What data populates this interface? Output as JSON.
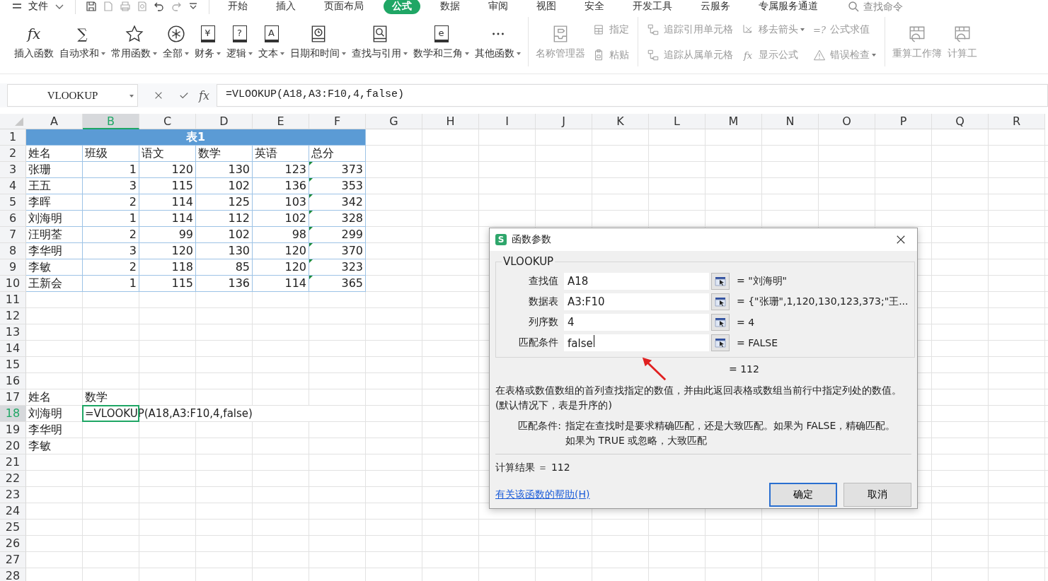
{
  "menu": {
    "file_label": "文件",
    "search_placeholder": "查找命令",
    "tabs": [
      {
        "label": "开始",
        "selected": false
      },
      {
        "label": "插入",
        "selected": false
      },
      {
        "label": "页面布局",
        "selected": false
      },
      {
        "label": "公式",
        "selected": true
      },
      {
        "label": "数据",
        "selected": false
      },
      {
        "label": "审阅",
        "selected": false
      },
      {
        "label": "视图",
        "selected": false
      },
      {
        "label": "安全",
        "selected": false
      },
      {
        "label": "开发工具",
        "selected": false
      },
      {
        "label": "云服务",
        "selected": false
      },
      {
        "label": "专属服务通道",
        "selected": false
      }
    ]
  },
  "ribbon": {
    "groups": [
      {
        "items": [
          {
            "kind": "large",
            "glyph": "fx",
            "label": "插入函数",
            "dropdown": false,
            "disabled": false
          },
          {
            "kind": "large",
            "glyph": "∑",
            "label": "自动求和",
            "dropdown": true,
            "disabled": false
          },
          {
            "kind": "large",
            "label": "常用函数",
            "dropdown": true,
            "disabled": false
          },
          {
            "kind": "large",
            "label": "全部",
            "dropdown": true,
            "disabled": false
          },
          {
            "kind": "large",
            "glyph": "¥",
            "label": "财务",
            "dropdown": true,
            "disabled": false
          },
          {
            "kind": "large",
            "glyph": "?",
            "label": "逻辑",
            "dropdown": true,
            "disabled": false
          },
          {
            "kind": "large",
            "glyph": "A",
            "label": "文本",
            "dropdown": true,
            "disabled": false
          },
          {
            "kind": "large",
            "label": "日期和时间",
            "dropdown": true,
            "disabled": false
          },
          {
            "kind": "large",
            "label": "查找与引用",
            "dropdown": true,
            "disabled": false
          },
          {
            "kind": "large",
            "glyph": "e",
            "label": "数学和三角",
            "dropdown": true,
            "disabled": false
          },
          {
            "kind": "large",
            "label": "其他函数",
            "dropdown": true,
            "disabled": false
          }
        ]
      },
      {
        "items": [
          {
            "kind": "large",
            "label": "名称管理器",
            "dropdown": false,
            "disabled": true
          },
          {
            "kind": "small",
            "label": "指定",
            "dropdown": false,
            "disabled": true
          },
          {
            "kind": "small",
            "label": "粘贴",
            "dropdown": false,
            "disabled": true
          }
        ]
      },
      {
        "items": [
          {
            "kind": "small",
            "label": "追踪引用单元格",
            "dropdown": false,
            "disabled": true
          },
          {
            "kind": "small",
            "label": "移去箭头",
            "dropdown": true,
            "disabled": true
          },
          {
            "kind": "small",
            "glyph": "=?",
            "label": "公式求值",
            "dropdown": false,
            "disabled": true
          },
          {
            "kind": "small",
            "label": "追踪从属单元格",
            "dropdown": false,
            "disabled": true
          },
          {
            "kind": "small",
            "glyph": "fx",
            "label": "显示公式",
            "dropdown": false,
            "disabled": true
          },
          {
            "kind": "small",
            "label": "错误检查",
            "dropdown": true,
            "disabled": true
          }
        ]
      },
      {
        "items": [
          {
            "kind": "large",
            "label": "重算工作簿",
            "dropdown": false,
            "disabled": true
          },
          {
            "kind": "large",
            "label": "计算工",
            "dropdown": false,
            "disabled": true
          }
        ]
      }
    ]
  },
  "formula_bar": {
    "name_box": "VLOOKUP",
    "fx": "fx",
    "formula": "=VLOOKUP(A18,A3:F10,4,false)"
  },
  "sheet": {
    "columns": [
      {
        "label": "A",
        "selected": false
      },
      {
        "label": "B",
        "selected": true
      },
      {
        "label": "C",
        "selected": false
      },
      {
        "label": "D",
        "selected": false
      },
      {
        "label": "E",
        "selected": false
      },
      {
        "label": "F",
        "selected": false
      },
      {
        "label": "G",
        "selected": false
      },
      {
        "label": "H",
        "selected": false
      },
      {
        "label": "I",
        "selected": false
      },
      {
        "label": "J",
        "selected": false
      },
      {
        "label": "K",
        "selected": false
      },
      {
        "label": "L",
        "selected": false
      },
      {
        "label": "M",
        "selected": false
      },
      {
        "label": "N",
        "selected": false
      },
      {
        "label": "O",
        "selected": false
      },
      {
        "label": "P",
        "selected": false
      },
      {
        "label": "Q",
        "selected": false
      },
      {
        "label": "R",
        "selected": false
      }
    ],
    "rows": [
      {
        "label": "1",
        "selected": false
      },
      {
        "label": "2",
        "selected": false
      },
      {
        "label": "3",
        "selected": false
      },
      {
        "label": "4",
        "selected": false
      },
      {
        "label": "5",
        "selected": false
      },
      {
        "label": "6",
        "selected": false
      },
      {
        "label": "7",
        "selected": false
      },
      {
        "label": "8",
        "selected": false
      },
      {
        "label": "9",
        "selected": false
      },
      {
        "label": "10",
        "selected": false
      },
      {
        "label": "11",
        "selected": false
      },
      {
        "label": "12",
        "selected": false
      },
      {
        "label": "13",
        "selected": false
      },
      {
        "label": "14",
        "selected": false
      },
      {
        "label": "15",
        "selected": false
      },
      {
        "label": "16",
        "selected": false
      },
      {
        "label": "17",
        "selected": false
      },
      {
        "label": "18",
        "selected": true
      },
      {
        "label": "19",
        "selected": false
      },
      {
        "label": "20",
        "selected": false
      },
      {
        "label": "21",
        "selected": false
      },
      {
        "label": "22",
        "selected": false
      },
      {
        "label": "23",
        "selected": false
      },
      {
        "label": "24",
        "selected": false
      },
      {
        "label": "25",
        "selected": false
      },
      {
        "label": "26",
        "selected": false
      },
      {
        "label": "27",
        "selected": false
      },
      {
        "label": "28",
        "selected": false
      }
    ]
  },
  "table": {
    "title": "表1",
    "formula_warnings": true,
    "headers": [
      "姓名",
      "班级",
      "语文",
      "数学",
      "英语",
      "总分"
    ],
    "rows": [
      {
        "name": "张珊",
        "values": [
          "1",
          "120",
          "130",
          "123",
          "373"
        ]
      },
      {
        "name": "王五",
        "values": [
          "3",
          "115",
          "102",
          "136",
          "353"
        ]
      },
      {
        "name": "李晖",
        "values": [
          "2",
          "114",
          "125",
          "103",
          "342"
        ]
      },
      {
        "name": "刘海明",
        "values": [
          "1",
          "114",
          "112",
          "102",
          "328"
        ]
      },
      {
        "name": "汪明荃",
        "values": [
          "2",
          "99",
          "102",
          "98",
          "299"
        ]
      },
      {
        "name": "李华明",
        "values": [
          "3",
          "120",
          "130",
          "120",
          "370"
        ]
      },
      {
        "name": "李敏",
        "values": [
          "2",
          "118",
          "85",
          "120",
          "323"
        ]
      },
      {
        "name": "王新会",
        "values": [
          "1",
          "115",
          "136",
          "114",
          "365"
        ]
      }
    ]
  },
  "lookup": {
    "headers": [
      "姓名",
      "数学"
    ],
    "rows": [
      {
        "name": "刘海明",
        "value": "=VLOOKUP(A18,A3:F10,4,false)",
        "active": true
      },
      {
        "name": "李华明",
        "active": false
      },
      {
        "name": "李敏",
        "active": false
      }
    ]
  },
  "dialog": {
    "logo": "S",
    "title": "函数参数",
    "function": "VLOOKUP",
    "params": [
      {
        "label": "查找值",
        "value": "A18",
        "result": "= \"刘海明\"",
        "focused": false
      },
      {
        "label": "数据表",
        "value": "A3:F10",
        "result": "= {\"张珊\",1,120,130,123,373;\"王...",
        "focused": false
      },
      {
        "label": "列序数",
        "value": "4",
        "result": "= 4",
        "focused": false
      },
      {
        "label": "匹配条件",
        "value": "false",
        "result": "= FALSE",
        "focused": true
      }
    ],
    "value_result": "= 112",
    "description": "在表格或数值数组的首列查找指定的数值，并由此返回表格或数组当前行中指定列处的数值。 (默认情况下，表是升序的)",
    "param_label": "匹配条件:",
    "param_description": "指定在查找时是要求精确匹配，还是大致匹配。如果为 FALSE，精确匹配。如果为 TRUE 或忽略，大致匹配",
    "calc_result": "计算结果 ＝ 112",
    "help_link": "有关该函数的帮助(H)",
    "buttons": [
      {
        "label": "确定",
        "default": true
      },
      {
        "label": "取消",
        "default": false
      }
    ]
  }
}
